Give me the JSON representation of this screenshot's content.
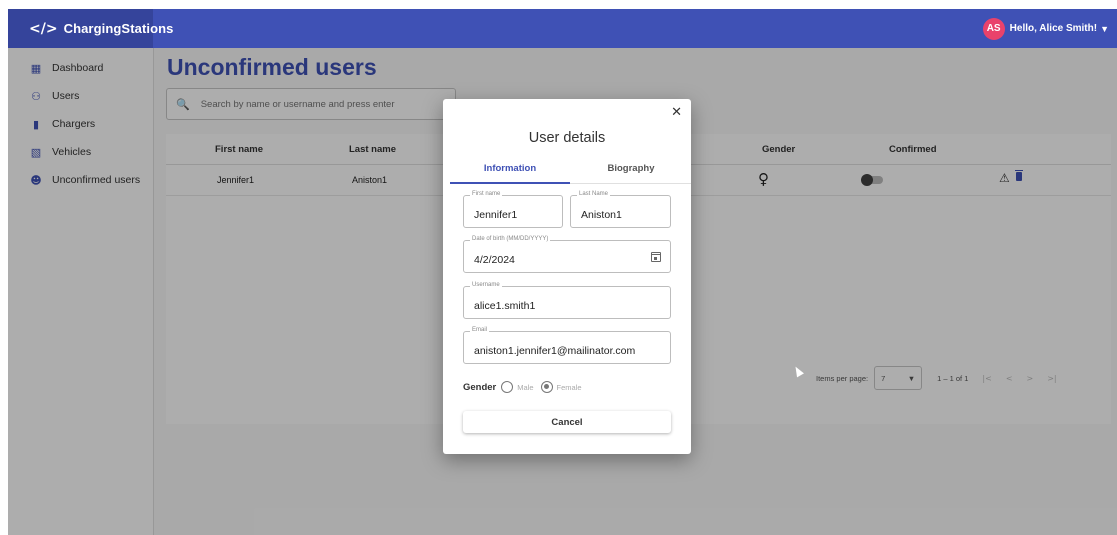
{
  "app": {
    "title": "ChargingStations",
    "logo_icon": "chevrons-logo-icon"
  },
  "user": {
    "initials": "AS",
    "greeting": "Hello, Alice Smith!",
    "avatar_color": "#e9426b"
  },
  "colors": {
    "primary": "#3f51b5",
    "brand_dark": "#35449b"
  },
  "sidebar": {
    "items": [
      {
        "label": "Dashboard",
        "icon": "dashboard-icon"
      },
      {
        "label": "Users",
        "icon": "users-icon"
      },
      {
        "label": "Chargers",
        "icon": "charger-icon"
      },
      {
        "label": "Vehicles",
        "icon": "car-icon"
      },
      {
        "label": "Unconfirmed users",
        "icon": "person-icon"
      }
    ]
  },
  "page": {
    "title": "Unconfirmed users"
  },
  "search": {
    "placeholder": "Search by name or username and press enter"
  },
  "table": {
    "headers": {
      "first_name": "First name",
      "last_name": "Last name",
      "gender": "Gender",
      "confirmed": "Confirmed"
    },
    "rows": [
      {
        "first_name": "Jennifer1",
        "last_name": "Aniston1",
        "gender_icon": "female-icon",
        "confirmed": false
      }
    ]
  },
  "paginator": {
    "items_per_page_label": "Items per page:",
    "items_per_page_value": "7",
    "range": "1 – 1 of 1"
  },
  "dialog": {
    "title": "User details",
    "tabs": {
      "information": "Information",
      "biography": "Biography"
    },
    "fields": {
      "first_name": {
        "label": "First name",
        "value": "Jennifer1"
      },
      "last_name": {
        "label": "Last Name",
        "value": "Aniston1"
      },
      "dob": {
        "label": "Date of birth (MM/DD/YYYY)",
        "value": "4/2/2024"
      },
      "username": {
        "label": "Username",
        "value": "alice1.smith1"
      },
      "email": {
        "label": "Email",
        "value": "aniston1.jennifer1@mailinator.com"
      }
    },
    "gender": {
      "label": "Gender",
      "options": {
        "male": "Male",
        "female": "Female"
      },
      "selected": "Female"
    },
    "cancel_label": "Cancel"
  }
}
